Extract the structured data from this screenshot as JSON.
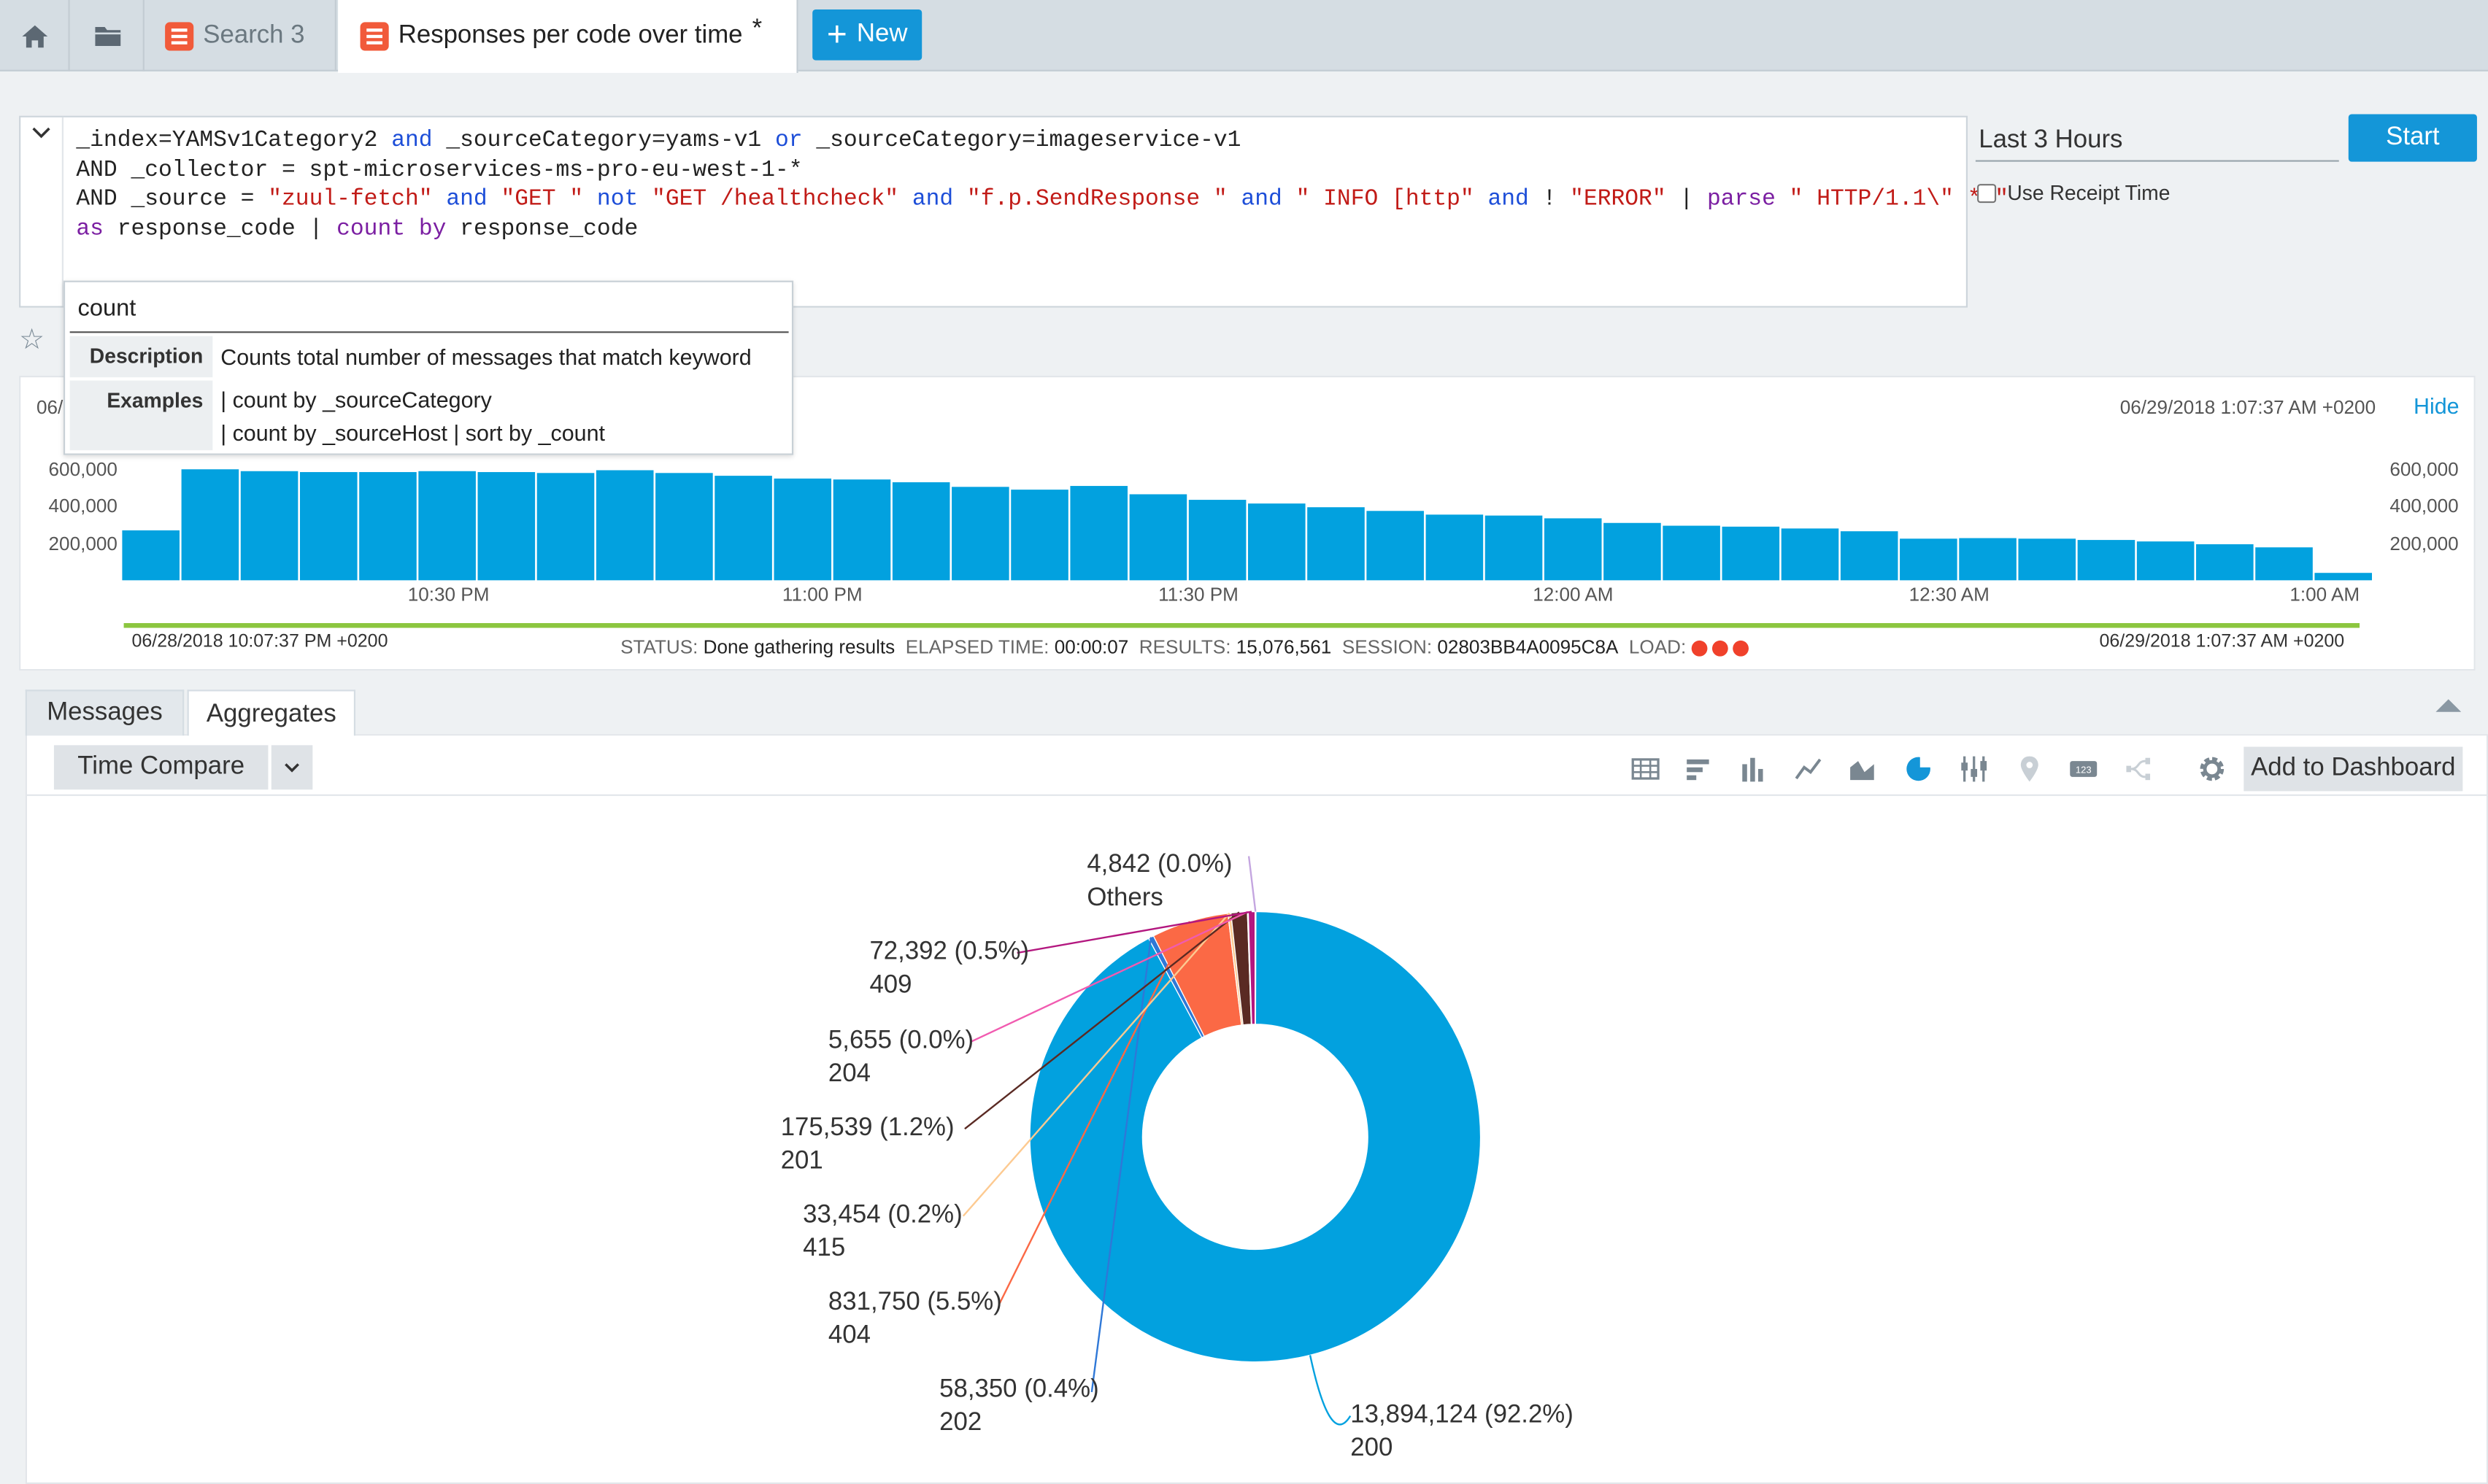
{
  "tabs": {
    "home_icon": "home-icon",
    "folder_icon": "folder-icon",
    "search3": "Search 3",
    "active": "Responses per code over time",
    "active_marker": "*",
    "new_button": "New"
  },
  "query": {
    "line1_a": "_index=YAMSv1Category2 ",
    "line1_and": "and",
    "line1_b": " _sourceCategory=yams-v1 ",
    "line1_or": "or",
    "line1_c": " _sourceCategory=imageservice-v1",
    "line2": "AND _collector = spt-microservices-ms-pro-eu-west-1-*",
    "line3_a": "AND _source = ",
    "line3_s1": "\"zuul-fetch\"",
    "line3_and1": " and ",
    "line3_s2": "\"GET \"",
    "line3_not": " not ",
    "line3_s3": "\"GET /healthcheck\"",
    "line3_and2": " and ",
    "line3_s4": "\"f.p.SendResponse \"",
    "line3_and3": " and ",
    "line3_s5": "\" INFO [http\"",
    "line3_and4": " and ",
    "line3_b": "! ",
    "line3_s6": "\"ERROR\"",
    "line3_c": " | ",
    "line3_parse": "parse",
    "line3_s7": " \" HTTP/1.1\\\" * \"",
    "line4_as": "as",
    "line4_a": " response_code | ",
    "line4_count": "count",
    "line4_b": " ",
    "line4_by": "by",
    "line4_c": " response_code"
  },
  "time_range": "Last 3 Hours",
  "start_button": "Start",
  "use_receipt_time": "Use Receipt Time",
  "tooltip": {
    "title": "count",
    "description_label": "Description",
    "description": "Counts total number of messages that match keyword",
    "examples_label": "Examples",
    "example1": "| count by _sourceCategory",
    "example2": "| count by _sourceHost | sort by _count"
  },
  "histogram": {
    "left_date_partial": "06/",
    "right_date": "06/29/2018 1:07:37 AM +0200",
    "hide": "Hide",
    "y_ticks": [
      "600,000",
      "400,000",
      "200,000"
    ],
    "x_ticks": [
      "10:30 PM",
      "11:00 PM",
      "11:30 PM",
      "12:00 AM",
      "12:30 AM",
      "1:00 AM"
    ],
    "bars": [
      270000,
      600000,
      590000,
      585000,
      585000,
      590000,
      585000,
      580000,
      595000,
      580000,
      565000,
      550000,
      545000,
      530000,
      505000,
      490000,
      510000,
      465000,
      435000,
      415000,
      395000,
      375000,
      355000,
      350000,
      335000,
      310000,
      295000,
      290000,
      280000,
      265000,
      225000,
      228000,
      225000,
      218000,
      210000,
      195000,
      178000,
      40000
    ],
    "start_time": "06/28/2018 10:07:37 PM +0200",
    "end_time": "06/29/2018 1:07:37 AM +0200",
    "status_label": "STATUS:",
    "status": "Done gathering results",
    "elapsed_label": "ELAPSED TIME:",
    "elapsed": "00:00:07",
    "results_label": "RESULTS:",
    "results": "15,076,561",
    "session_label": "SESSION:",
    "session": "02803BB4A0095C8A",
    "load_label": "LOAD:"
  },
  "lower": {
    "messages_tab": "Messages",
    "aggregates_tab": "Aggregates",
    "time_compare": "Time Compare",
    "add_to_dashboard": "Add to Dashboard",
    "chart_icons": [
      "table-icon",
      "bar-horizontal-icon",
      "column-chart-icon",
      "line-chart-icon",
      "area-chart-icon",
      "pie-chart-icon",
      "box-plot-icon",
      "map-pin-icon",
      "single-value-icon",
      "sankey-icon",
      "gear-icon"
    ]
  },
  "chart_data": {
    "type": "pie",
    "donut": true,
    "slices": [
      {
        "label": "200",
        "value": 13894124,
        "text": "13,894,124 (92.2%)",
        "color": "#02a1df"
      },
      {
        "label": "202",
        "value": 58350,
        "text": "58,350 (0.4%)",
        "color": "#2f78d7"
      },
      {
        "label": "404",
        "value": 831750,
        "text": "831,750 (5.5%)",
        "color": "#fb6945"
      },
      {
        "label": "415",
        "value": 33454,
        "text": "33,454 (0.2%)",
        "color": "#fdca91"
      },
      {
        "label": "201",
        "value": 175539,
        "text": "175,539 (1.2%)",
        "color": "#5a2a23"
      },
      {
        "label": "204",
        "value": 5655,
        "text": "5,655 (0.0%)",
        "color": "#f15bb0"
      },
      {
        "label": "409",
        "value": 72392,
        "text": "72,392 (0.5%)",
        "color": "#b3177f"
      },
      {
        "label": "Others",
        "value": 4842,
        "text": "4,842 (0.0%)",
        "color": "#c4a6e0"
      }
    ]
  }
}
